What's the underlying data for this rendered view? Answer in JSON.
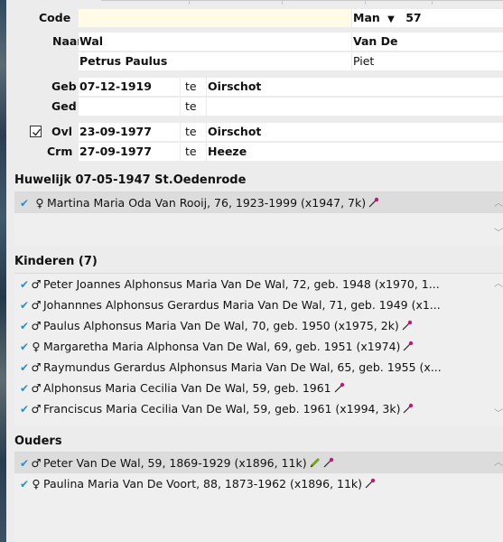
{
  "form": {
    "code_label": "Code",
    "code_value": "",
    "gender": "Man",
    "gender_arrow": "▼",
    "age": "57",
    "naam_label": "Naam",
    "surname": "Wal",
    "prefix": "Van De",
    "given_names": "Petrus Paulus",
    "nickname": "Piet",
    "geb_label": "Geb",
    "geb_date": "07-12-1919",
    "geb_te": "te",
    "geb_place": "Oirschot",
    "ged_label": "Ged",
    "ged_date": "",
    "ged_te": "te",
    "ged_place": "",
    "ovl_label": "Ovl",
    "ovl_checked": true,
    "ovl_date": "23-09-1977",
    "ovl_te": "te",
    "ovl_place": "Oirschot",
    "crm_label": "Crm",
    "crm_date": "27-09-1977",
    "crm_te": "te",
    "crm_place": "Heeze"
  },
  "huwelijk": {
    "title": "Huwelijk 07-05-1947 St.Oedenrode",
    "items": [
      {
        "sex": "♀",
        "text": "Martina Maria Oda Van Rooij, 76, 1923-1999 (x1947, 7k)",
        "pin": true,
        "pencil": false
      }
    ]
  },
  "kinderen": {
    "title": "Kinderen (7)",
    "items": [
      {
        "sex": "♂",
        "text": "Peter Joannes Alphonsus Maria Van De Wal, 72, geb. 1948 (x1970, 1...",
        "pin": false
      },
      {
        "sex": "♂",
        "text": "Johannnes Alphonsus Gerardus Maria Van De Wal, 71, geb. 1949 (x1...",
        "pin": false
      },
      {
        "sex": "♂",
        "text": "Paulus Alphonsus Maria Van De Wal, 70, geb. 1950 (x1975, 2k)",
        "pin": true
      },
      {
        "sex": "♀",
        "text": "Margaretha Maria Alphonsa Van De Wal, 69, geb. 1951 (x1974)",
        "pin": true
      },
      {
        "sex": "♂",
        "text": "Raymundus Gerardus Alphonsus Maria Van De Wal, 65, geb. 1955 (x...",
        "pin": false
      },
      {
        "sex": "♂",
        "text": "Alphonsus Maria Cecilia Van De Wal, 59, geb. 1961",
        "pin": true
      },
      {
        "sex": "♂",
        "text": "Franciscus Maria Cecilia Van De Wal, 59, geb. 1961 (x1994, 3k)",
        "pin": true
      }
    ]
  },
  "ouders": {
    "title": "Ouders",
    "items": [
      {
        "sex": "♂",
        "text": "Peter Van De Wal, 59, 1869-1929 (x1896, 11k)",
        "pin": true,
        "pencil": true
      },
      {
        "sex": "♀",
        "text": "Paulina Maria Van De Voort, 88, 1873-1962 (x1896, 11k)",
        "pin": true,
        "pencil": false
      }
    ]
  },
  "colors": {
    "chevron": "#2c8fc4",
    "pin": "#c2187a",
    "pencil": "#7aa020"
  }
}
